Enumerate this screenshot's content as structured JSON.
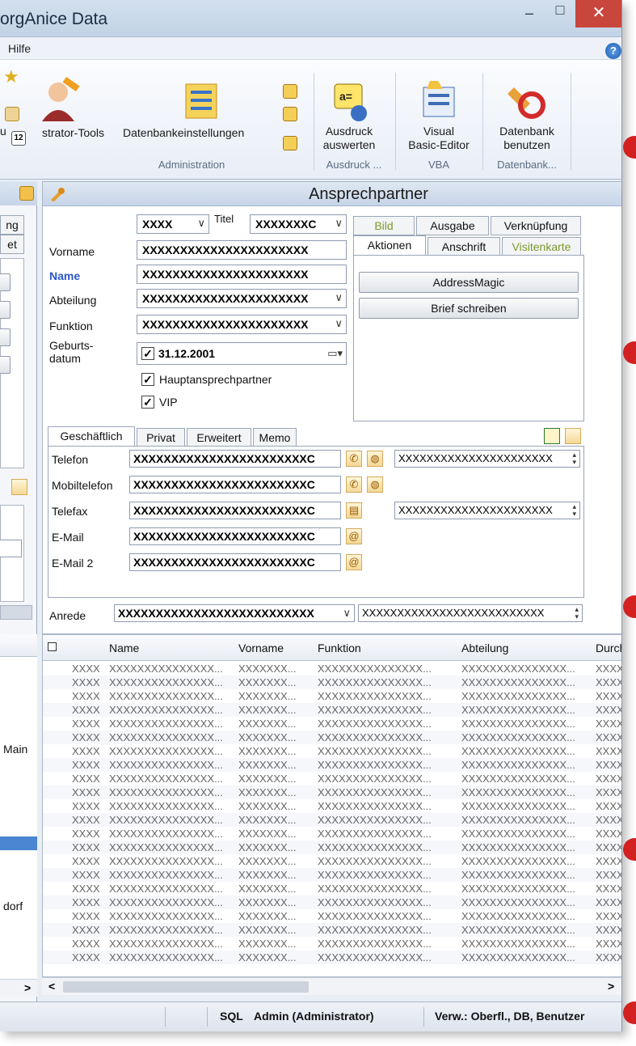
{
  "window": {
    "title": "orgAnice Data",
    "minimize": "–",
    "maximize": "□",
    "close": "✕"
  },
  "menu": {
    "help": "Hilfe",
    "help_icon": "?"
  },
  "ribbon": {
    "admin_tools": "strator-Tools",
    "db_settings": "Datenbankeinstellungen",
    "print_eval": [
      "Ausdruck",
      "auswerten"
    ],
    "vba_editor": [
      "Visual",
      "Basic-Editor"
    ],
    "db_use": [
      "Datenbank",
      "benutzen"
    ],
    "groups": [
      "Administration",
      "Ausdruck ...",
      "VBA",
      "Datenbank..."
    ],
    "partial_u": "u",
    "icon_date": "12"
  },
  "left_pane": {
    "tab1": "ng",
    "tab2": "et",
    "items": [
      "Main",
      "dorf"
    ],
    "scroll_right": ">"
  },
  "form": {
    "title": "Ansprechpartner",
    "salutation_value": "XXXX",
    "title_label": "Titel",
    "title_value": "XXXXXXXC",
    "firstname_label": "Vorname",
    "firstname_value": "XXXXXXXXXXXXXXXXXXXXXX",
    "name_label": "Name",
    "name_value": "XXXXXXXXXXXXXXXXXXXXXX",
    "department_label": "Abteilung",
    "department_value": "XXXXXXXXXXXXXXXXXXXXXX",
    "function_label": "Funktion",
    "function_value": "XXXXXXXXXXXXXXXXXXXXXX",
    "birthdate_label1": "Geburts-",
    "birthdate_label2": "datum",
    "birthdate_value": "31.12.2001",
    "main_contact_label": "Hauptansprechpartner",
    "vip_label": "VIP",
    "right_tabs": {
      "bild": "Bild",
      "ausgabe": "Ausgabe",
      "verknuepfung": "Verknüpfung",
      "aktionen": "Aktionen",
      "anschrift": "Anschrift",
      "visitenkarte": "Visitenkarte"
    },
    "btn_addressmagic": "AddressMagic",
    "btn_letter": "Brief schreiben",
    "lower_tabs": {
      "geschaeftlich": "Geschäftlich",
      "privat": "Privat",
      "erweitert": "Erweitert",
      "memo": "Memo"
    },
    "phone_label": "Telefon",
    "phone_value": "XXXXXXXXXXXXXXXXXXXXXXXC",
    "phone_extra": "XXXXXXXXXXXXXXXXXXXXXX",
    "mobile_label": "Mobiltelefon",
    "mobile_value": "XXXXXXXXXXXXXXXXXXXXXXXC",
    "fax_label": "Telefax",
    "fax_value": "XXXXXXXXXXXXXXXXXXXXXXXC",
    "fax_extra": "XXXXXXXXXXXXXXXXXXXXXX",
    "email_label": "E-Mail",
    "email_value": "XXXXXXXXXXXXXXXXXXXXXXXC",
    "email2_label": "E-Mail 2",
    "email2_value": "XXXXXXXXXXXXXXXXXXXXXXXC",
    "anrede_label": "Anrede",
    "anrede_value": "XXXXXXXXXXXXXXXXXXXXXXXXXX",
    "anrede_extra": "XXXXXXXXXXXXXXXXXXXXXXXXXX"
  },
  "grid": {
    "headers": [
      "Name",
      "Vorname",
      "Funktion",
      "Abteilung",
      "Durch"
    ],
    "rows": [
      [
        "XXXX",
        "XXXXXXXXXXXXXXX...",
        "XXXXXXX...",
        "XXXXXXXXXXXXXXX...",
        "XXXXXXXXXXXXXXX...",
        "XXXX"
      ],
      [
        "XXXX",
        "XXXXXXXXXXXXXXX...",
        "XXXXXXX...",
        "XXXXXXXXXXXXXXX...",
        "XXXXXXXXXXXXXXX...",
        "XXXX"
      ],
      [
        "XXXX",
        "XXXXXXXXXXXXXXX...",
        "XXXXXXX...",
        "XXXXXXXXXXXXXXX...",
        "XXXXXXXXXXXXXXX...",
        "XXXX"
      ],
      [
        "XXXX",
        "XXXXXXXXXXXXXXX...",
        "XXXXXXX...",
        "XXXXXXXXXXXXXXX...",
        "XXXXXXXXXXXXXXX...",
        "XXXX"
      ],
      [
        "XXXX",
        "XXXXXXXXXXXXXXX...",
        "XXXXXXX...",
        "XXXXXXXXXXXXXXX...",
        "XXXXXXXXXXXXXXX...",
        "XXXX"
      ],
      [
        "XXXX",
        "XXXXXXXXXXXXXXX...",
        "XXXXXXX...",
        "XXXXXXXXXXXXXXX...",
        "XXXXXXXXXXXXXXX...",
        "XXXX"
      ],
      [
        "XXXX",
        "XXXXXXXXXXXXXXX...",
        "XXXXXXX...",
        "XXXXXXXXXXXXXXX...",
        "XXXXXXXXXXXXXXX...",
        "XXXX"
      ],
      [
        "XXXX",
        "XXXXXXXXXXXXXXX...",
        "XXXXXXX...",
        "XXXXXXXXXXXXXXX...",
        "XXXXXXXXXXXXXXX...",
        "XXXX"
      ],
      [
        "XXXX",
        "XXXXXXXXXXXXXXX...",
        "XXXXXXX...",
        "XXXXXXXXXXXXXXX...",
        "XXXXXXXXXXXXXXX...",
        "XXXX"
      ],
      [
        "XXXX",
        "XXXXXXXXXXXXXXX...",
        "XXXXXXX...",
        "XXXXXXXXXXXXXXX...",
        "XXXXXXXXXXXXXXX...",
        "XXXX"
      ],
      [
        "XXXX",
        "XXXXXXXXXXXXXXX...",
        "XXXXXXX...",
        "XXXXXXXXXXXXXXX...",
        "XXXXXXXXXXXXXXX...",
        "XXXX"
      ],
      [
        "XXXX",
        "XXXXXXXXXXXXXXX...",
        "XXXXXXX...",
        "XXXXXXXXXXXXXXX...",
        "XXXXXXXXXXXXXXX...",
        "XXXX"
      ],
      [
        "XXXX",
        "XXXXXXXXXXXXXXX...",
        "XXXXXXX...",
        "XXXXXXXXXXXXXXX...",
        "XXXXXXXXXXXXXXX...",
        "XXXX"
      ],
      [
        "XXXX",
        "XXXXXXXXXXXXXXX...",
        "XXXXXXX...",
        "XXXXXXXXXXXXXXX...",
        "XXXXXXXXXXXXXXX...",
        "XXXX"
      ],
      [
        "XXXX",
        "XXXXXXXXXXXXXXX...",
        "XXXXXXX...",
        "XXXXXXXXXXXXXXX...",
        "XXXXXXXXXXXXXXX...",
        "XXXX"
      ],
      [
        "XXXX",
        "XXXXXXXXXXXXXXX...",
        "XXXXXXX...",
        "XXXXXXXXXXXXXXX...",
        "XXXXXXXXXXXXXXX...",
        "XXXX"
      ],
      [
        "XXXX",
        "XXXXXXXXXXXXXXX...",
        "XXXXXXX...",
        "XXXXXXXXXXXXXXX...",
        "XXXXXXXXXXXXXXX...",
        "XXXX"
      ],
      [
        "XXXX",
        "XXXXXXXXXXXXXXX...",
        "XXXXXXX...",
        "XXXXXXXXXXXXXXX...",
        "XXXXXXXXXXXXXXX...",
        "XXXX"
      ],
      [
        "XXXX",
        "XXXXXXXXXXXXXXX...",
        "XXXXXXX...",
        "XXXXXXXXXXXXXXX...",
        "XXXXXXXXXXXXXXX...",
        "XXXX"
      ],
      [
        "XXXX",
        "XXXXXXXXXXXXXXX...",
        "XXXXXXX...",
        "XXXXXXXXXXXXXXX...",
        "XXXXXXXXXXXXXXX...",
        "XXXX"
      ],
      [
        "XXXX",
        "XXXXXXXXXXXXXXX...",
        "XXXXXXX...",
        "XXXXXXXXXXXXXXX...",
        "XXXXXXXXXXXXXXX...",
        "XXXX"
      ],
      [
        "XXXX",
        "XXXXXXXXXXXXXXX...",
        "XXXXXXX...",
        "XXXXXXXXXXXXXXX...",
        "XXXXXXXXXXXXXXX...",
        "XXXX"
      ]
    ],
    "scroll_left": "<",
    "scroll_right": ">"
  },
  "status": {
    "sql": "SQL",
    "user": "Admin (Administrator)",
    "verw": "Verw.: Oberfl., DB, Benutzer"
  },
  "colors": {
    "accent": "#2b56c6",
    "close": "#c9463d",
    "annotation": "#d32020",
    "selection": "#4a86d1"
  }
}
